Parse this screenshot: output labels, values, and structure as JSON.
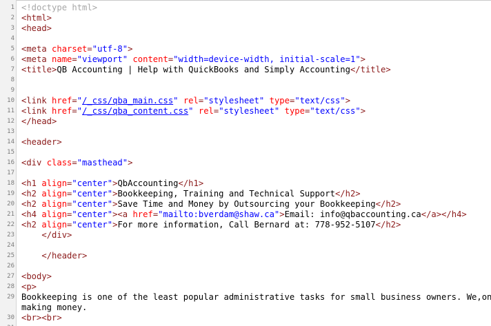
{
  "source_view": {
    "lines": [
      {
        "num": "1",
        "segments": [
          {
            "k": "dt",
            "t": "<!doctype html>"
          }
        ]
      },
      {
        "num": "2",
        "segments": [
          {
            "k": "t",
            "t": "<html>"
          }
        ]
      },
      {
        "num": "3",
        "segments": [
          {
            "k": "t",
            "t": "<head>"
          }
        ]
      },
      {
        "num": "4",
        "segments": []
      },
      {
        "num": "5",
        "segments": [
          {
            "k": "t",
            "t": "<meta "
          },
          {
            "k": "an",
            "t": "charset"
          },
          {
            "k": "t",
            "t": "="
          },
          {
            "k": "av",
            "t": "\"utf-8\""
          },
          {
            "k": "t",
            "t": ">"
          }
        ]
      },
      {
        "num": "6",
        "segments": [
          {
            "k": "t",
            "t": "<meta "
          },
          {
            "k": "an",
            "t": "name"
          },
          {
            "k": "t",
            "t": "="
          },
          {
            "k": "av",
            "t": "\"viewport\""
          },
          {
            "k": "tx",
            "t": " "
          },
          {
            "k": "an",
            "t": "content"
          },
          {
            "k": "t",
            "t": "="
          },
          {
            "k": "av",
            "t": "\"width=device-width, initial-scale=1\""
          },
          {
            "k": "t",
            "t": ">"
          }
        ]
      },
      {
        "num": "7",
        "segments": [
          {
            "k": "t",
            "t": "<title>"
          },
          {
            "k": "tx",
            "t": "QB Accounting | Help with QuickBooks and Simply Accounting"
          },
          {
            "k": "t",
            "t": "</title>"
          }
        ]
      },
      {
        "num": "8",
        "segments": []
      },
      {
        "num": "9",
        "segments": []
      },
      {
        "num": "10",
        "segments": [
          {
            "k": "t",
            "t": "<link "
          },
          {
            "k": "an",
            "t": "href"
          },
          {
            "k": "t",
            "t": "="
          },
          {
            "k": "av",
            "t": "\""
          },
          {
            "k": "lk",
            "t": "/_css/qba_main.css"
          },
          {
            "k": "av",
            "t": "\""
          },
          {
            "k": "tx",
            "t": " "
          },
          {
            "k": "an",
            "t": "rel"
          },
          {
            "k": "t",
            "t": "="
          },
          {
            "k": "av",
            "t": "\"stylesheet\""
          },
          {
            "k": "tx",
            "t": " "
          },
          {
            "k": "an",
            "t": "type"
          },
          {
            "k": "t",
            "t": "="
          },
          {
            "k": "av",
            "t": "\"text/css\""
          },
          {
            "k": "t",
            "t": ">"
          }
        ]
      },
      {
        "num": "11",
        "segments": [
          {
            "k": "t",
            "t": "<link "
          },
          {
            "k": "an",
            "t": "href"
          },
          {
            "k": "t",
            "t": "="
          },
          {
            "k": "av",
            "t": "\""
          },
          {
            "k": "lk",
            "t": "/_css/qba_content.css"
          },
          {
            "k": "av",
            "t": "\""
          },
          {
            "k": "tx",
            "t": " "
          },
          {
            "k": "an",
            "t": "rel"
          },
          {
            "k": "t",
            "t": "="
          },
          {
            "k": "av",
            "t": "\"stylesheet\""
          },
          {
            "k": "tx",
            "t": " "
          },
          {
            "k": "an",
            "t": "type"
          },
          {
            "k": "t",
            "t": "="
          },
          {
            "k": "av",
            "t": "\"text/css\""
          },
          {
            "k": "t",
            "t": ">"
          }
        ]
      },
      {
        "num": "12",
        "segments": [
          {
            "k": "t",
            "t": "</head>"
          }
        ]
      },
      {
        "num": "13",
        "segments": []
      },
      {
        "num": "14",
        "segments": [
          {
            "k": "t",
            "t": "<header>"
          }
        ]
      },
      {
        "num": "15",
        "segments": []
      },
      {
        "num": "16",
        "segments": [
          {
            "k": "t",
            "t": "<div "
          },
          {
            "k": "an",
            "t": "class"
          },
          {
            "k": "t",
            "t": "="
          },
          {
            "k": "av",
            "t": "\"masthead\""
          },
          {
            "k": "t",
            "t": ">"
          }
        ]
      },
      {
        "num": "17",
        "segments": []
      },
      {
        "num": "18",
        "segments": [
          {
            "k": "t",
            "t": "<h1 "
          },
          {
            "k": "an",
            "t": "align"
          },
          {
            "k": "t",
            "t": "="
          },
          {
            "k": "av",
            "t": "\"center\""
          },
          {
            "k": "t",
            "t": ">"
          },
          {
            "k": "tx",
            "t": "QbAccounting"
          },
          {
            "k": "t",
            "t": "</h1>"
          }
        ]
      },
      {
        "num": "19",
        "segments": [
          {
            "k": "t",
            "t": "<h2 "
          },
          {
            "k": "an",
            "t": "align"
          },
          {
            "k": "t",
            "t": "="
          },
          {
            "k": "av",
            "t": "\"center\""
          },
          {
            "k": "t",
            "t": ">"
          },
          {
            "k": "tx",
            "t": "Bookkeeping, Training and Technical Support"
          },
          {
            "k": "t",
            "t": "</h2>"
          }
        ]
      },
      {
        "num": "20",
        "segments": [
          {
            "k": "t",
            "t": "<h2 "
          },
          {
            "k": "an",
            "t": "align"
          },
          {
            "k": "t",
            "t": "="
          },
          {
            "k": "av",
            "t": "\"center\""
          },
          {
            "k": "t",
            "t": ">"
          },
          {
            "k": "tx",
            "t": "Save Time and Money by Outsourcing your Bookkeeping"
          },
          {
            "k": "t",
            "t": "</h2>"
          }
        ]
      },
      {
        "num": "21",
        "segments": [
          {
            "k": "t",
            "t": "<h4 "
          },
          {
            "k": "an",
            "t": "align"
          },
          {
            "k": "t",
            "t": "="
          },
          {
            "k": "av",
            "t": "\"center\""
          },
          {
            "k": "t",
            "t": "><a "
          },
          {
            "k": "an",
            "t": "href"
          },
          {
            "k": "t",
            "t": "="
          },
          {
            "k": "av",
            "t": "\"mailto:bverdam@shaw.ca\""
          },
          {
            "k": "t",
            "t": ">"
          },
          {
            "k": "tx",
            "t": "Email: info@qbaccounting.ca"
          },
          {
            "k": "t",
            "t": "</a></h4>"
          }
        ]
      },
      {
        "num": "22",
        "segments": [
          {
            "k": "t",
            "t": "<h2 "
          },
          {
            "k": "an",
            "t": "align"
          },
          {
            "k": "t",
            "t": "="
          },
          {
            "k": "av",
            "t": "\"center\""
          },
          {
            "k": "t",
            "t": ">"
          },
          {
            "k": "tx",
            "t": "For more information, Call Bernard at: 778-952-5107"
          },
          {
            "k": "t",
            "t": "</h2>"
          }
        ]
      },
      {
        "num": "23",
        "segments": [
          {
            "k": "tx",
            "t": "    "
          },
          {
            "k": "t",
            "t": "</div>"
          }
        ]
      },
      {
        "num": "24",
        "segments": []
      },
      {
        "num": "25",
        "segments": [
          {
            "k": "tx",
            "t": "    "
          },
          {
            "k": "t",
            "t": "</header>"
          }
        ]
      },
      {
        "num": "26",
        "segments": []
      },
      {
        "num": "27",
        "segments": [
          {
            "k": "t",
            "t": "<body>"
          }
        ]
      },
      {
        "num": "28",
        "segments": [
          {
            "k": "t",
            "t": "<p>"
          }
        ]
      },
      {
        "num": "29",
        "segments": [
          {
            "k": "tx",
            "t": "Bookkeeping is one of the least popular administrative tasks for small business owners. We,on th"
          }
        ]
      },
      {
        "num": "",
        "segments": [
          {
            "k": "tx",
            "t": "making money."
          }
        ]
      },
      {
        "num": "30",
        "segments": [
          {
            "k": "t",
            "t": "<br><br>"
          }
        ]
      },
      {
        "num": "31",
        "segments": []
      }
    ]
  }
}
